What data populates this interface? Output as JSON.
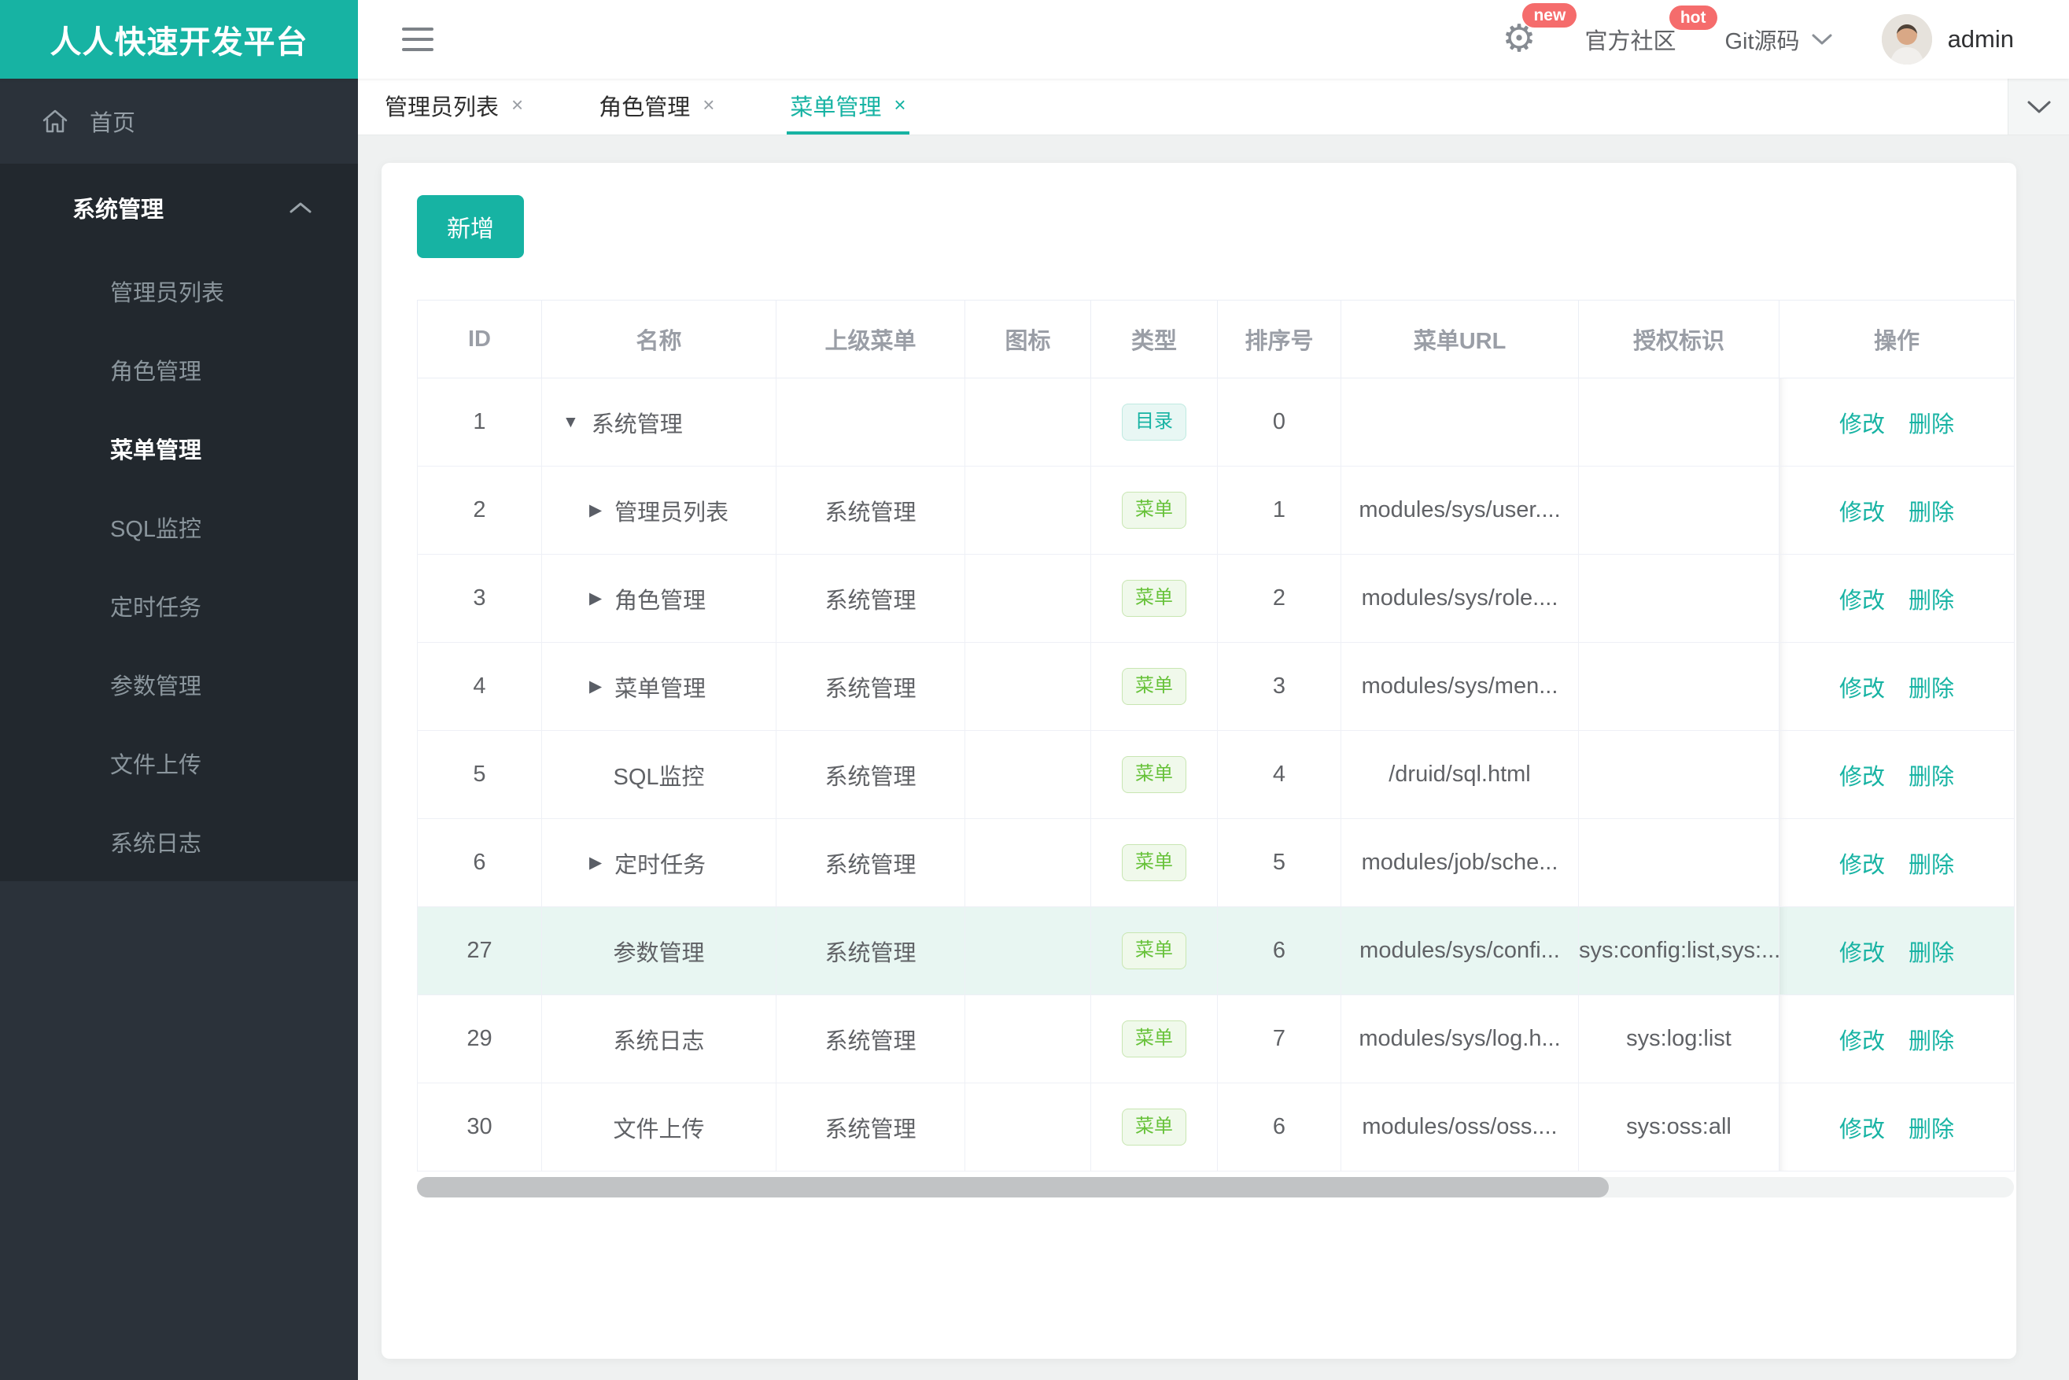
{
  "app": {
    "logo": "人人快速开发平台"
  },
  "topbar": {
    "badge_new": "new",
    "community": "官方社区",
    "badge_hot": "hot",
    "git": "Git源码",
    "user": "admin"
  },
  "sidebar": {
    "home": "首页",
    "group": "系统管理",
    "items": [
      {
        "key": "admin-list",
        "label": "管理员列表",
        "active": false
      },
      {
        "key": "role",
        "label": "角色管理",
        "active": false
      },
      {
        "key": "menu",
        "label": "菜单管理",
        "active": true
      },
      {
        "key": "sql",
        "label": "SQL监控",
        "active": false
      },
      {
        "key": "job",
        "label": "定时任务",
        "active": false
      },
      {
        "key": "config",
        "label": "参数管理",
        "active": false
      },
      {
        "key": "oss",
        "label": "文件上传",
        "active": false
      },
      {
        "key": "log",
        "label": "系统日志",
        "active": false
      }
    ]
  },
  "tabs": {
    "close_glyph": "×",
    "items": [
      {
        "key": "admin-list",
        "label": "管理员列表",
        "active": false
      },
      {
        "key": "role",
        "label": "角色管理",
        "active": false
      },
      {
        "key": "menu",
        "label": "菜单管理",
        "active": true
      }
    ]
  },
  "toolbar": {
    "add_label": "新增"
  },
  "table": {
    "columns": [
      "ID",
      "名称",
      "上级菜单",
      "图标",
      "类型",
      "排序号",
      "菜单URL",
      "授权标识",
      "操作"
    ],
    "expand_glyphs": {
      "down": "▼",
      "right": "▶"
    },
    "actions": [
      "修改",
      "删除"
    ],
    "rows": [
      {
        "id": "1",
        "name": "系统管理",
        "expand": "down",
        "indent": 0,
        "parent": "",
        "icon": "",
        "type": "目录",
        "type_class": "dir",
        "order": "0",
        "url": "",
        "auth": "",
        "highlight": false
      },
      {
        "id": "2",
        "name": "管理员列表",
        "expand": "right",
        "indent": 1,
        "parent": "系统管理",
        "icon": "",
        "type": "菜单",
        "type_class": "menu",
        "order": "1",
        "url": "modules/sys/user....",
        "auth": "",
        "highlight": false
      },
      {
        "id": "3",
        "name": "角色管理",
        "expand": "right",
        "indent": 1,
        "parent": "系统管理",
        "icon": "",
        "type": "菜单",
        "type_class": "menu",
        "order": "2",
        "url": "modules/sys/role....",
        "auth": "",
        "highlight": false
      },
      {
        "id": "4",
        "name": "菜单管理",
        "expand": "right",
        "indent": 1,
        "parent": "系统管理",
        "icon": "",
        "type": "菜单",
        "type_class": "menu",
        "order": "3",
        "url": "modules/sys/men...",
        "auth": "",
        "highlight": false
      },
      {
        "id": "5",
        "name": "SQL监控",
        "expand": null,
        "indent": 0,
        "parent": "系统管理",
        "icon": "",
        "type": "菜单",
        "type_class": "menu",
        "order": "4",
        "url": "/druid/sql.html",
        "auth": "",
        "highlight": false
      },
      {
        "id": "6",
        "name": "定时任务",
        "expand": "right",
        "indent": 1,
        "parent": "系统管理",
        "icon": "",
        "type": "菜单",
        "type_class": "menu",
        "order": "5",
        "url": "modules/job/sche...",
        "auth": "",
        "highlight": false
      },
      {
        "id": "27",
        "name": "参数管理",
        "expand": null,
        "indent": 0,
        "parent": "系统管理",
        "icon": "",
        "type": "菜单",
        "type_class": "menu",
        "order": "6",
        "url": "modules/sys/confi...",
        "auth": "sys:config:list,sys:...",
        "highlight": true
      },
      {
        "id": "29",
        "name": "系统日志",
        "expand": null,
        "indent": 0,
        "parent": "系统管理",
        "icon": "",
        "type": "菜单",
        "type_class": "menu",
        "order": "7",
        "url": "modules/sys/log.h...",
        "auth": "sys:log:list",
        "highlight": false
      },
      {
        "id": "30",
        "name": "文件上传",
        "expand": null,
        "indent": 0,
        "parent": "系统管理",
        "icon": "",
        "type": "菜单",
        "type_class": "menu",
        "order": "6",
        "url": "modules/oss/oss....",
        "auth": "sys:oss:all",
        "highlight": false
      }
    ]
  },
  "colors": {
    "accent": "#17b3a3",
    "success": "#67c23a",
    "danger": "#f56c6c",
    "sidebar_bg": "#2b323a",
    "sidebar_sub_bg": "#22282e"
  }
}
